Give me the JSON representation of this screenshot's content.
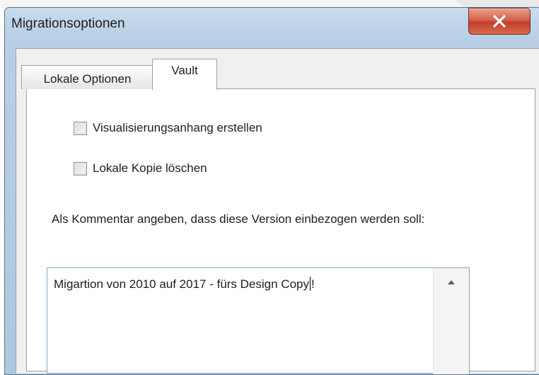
{
  "window": {
    "title": "Migrationsoptionen",
    "close_symbol": "X"
  },
  "tabs": [
    {
      "label": "Lokale Optionen",
      "active": false
    },
    {
      "label": "Vault",
      "active": true
    }
  ],
  "options": [
    {
      "label": "Visualisierungsanhang erstellen",
      "checked": false
    },
    {
      "label": "Lokale Kopie löschen",
      "checked": false
    }
  ],
  "comment": {
    "label": "Als Kommentar angeben, dass diese Version einbezogen werden soll:",
    "value_before_caret": "Migartion von 2010 auf 2017 - fürs Design Copy",
    "value_after_caret": "!"
  },
  "colors": {
    "close_button": "#c84a33",
    "titlebar": "#b9cfe6"
  },
  "icons": {
    "close": "close-icon",
    "scroll_up": "scroll-up-arrow-icon",
    "checkbox": "checkbox-icon"
  }
}
